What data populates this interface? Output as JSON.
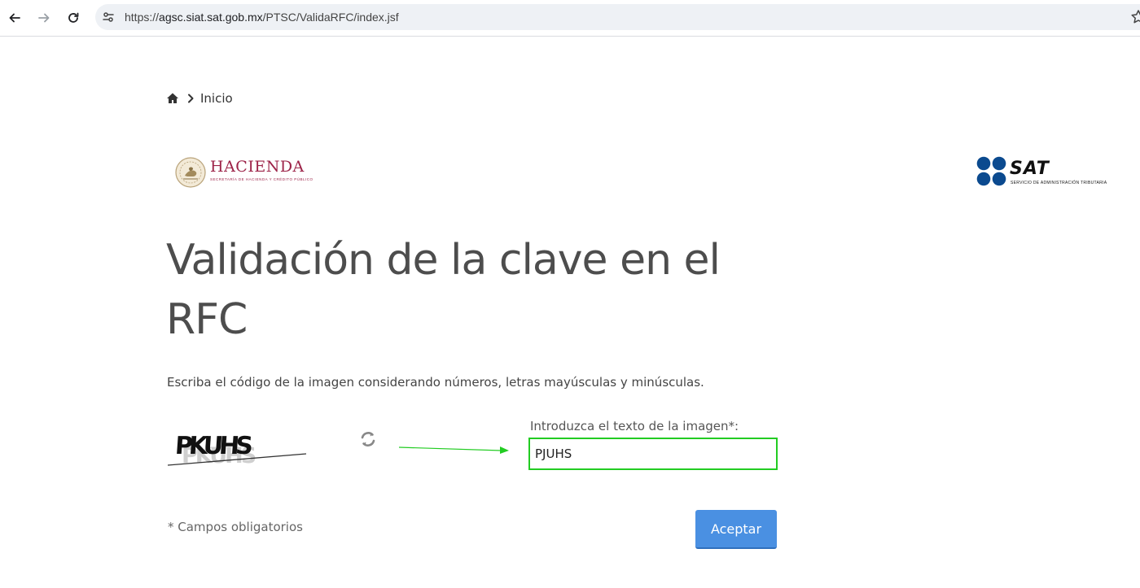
{
  "browser": {
    "url_prefix": "https://",
    "url_host": "agsc.siat.sat.gob.mx",
    "url_path": "/PTSC/ValidaRFC/index.jsf",
    "icons": {
      "back": "arrow-left-icon",
      "forward": "arrow-right-icon",
      "reload": "reload-icon",
      "site_info": "tune-icon",
      "bookmark": "star-icon"
    }
  },
  "breadcrumb": {
    "home_icon": "home-icon",
    "separator_icon": "chevron-right-icon",
    "label": "Inicio"
  },
  "logos": {
    "hacienda": {
      "title": "HACIENDA",
      "subtitle": "SECRETARÍA DE HACIENDA Y CRÉDITO PÚBLICO",
      "color": "#9d2449"
    },
    "sat": {
      "title": "SAT",
      "subtitle": "SERVICIO DE ADMINISTRACIÓN TRIBUTARIA",
      "color": "#0b4a8f"
    }
  },
  "main": {
    "title": "Validación de la clave en el RFC",
    "instructions": "Escriba el código de la imagen considerando números, letras mayúsculas y minúsculas.",
    "captcha": {
      "image_text": "PKUHS",
      "refresh_icon": "refresh-icon",
      "label": "Introduzca el texto de la imagen*:",
      "value": "PJUHS",
      "annotation_arrow_color": "#22cc22"
    },
    "required_note": "* Campos obligatorios",
    "submit_label": "Aceptar",
    "accent_color": "#4a90e2"
  }
}
